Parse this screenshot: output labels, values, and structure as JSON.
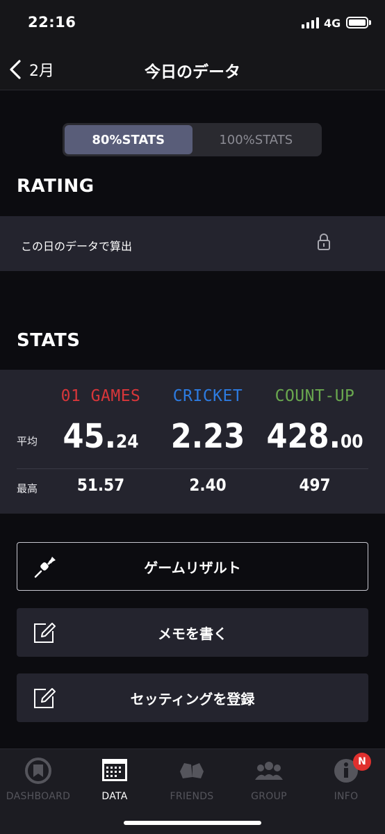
{
  "status_bar": {
    "time": "22:16",
    "network": "4G"
  },
  "nav": {
    "back_label": "2月",
    "title": "今日のデータ"
  },
  "segment": {
    "options": [
      "80%STATS",
      "100%STATS"
    ],
    "selected": "80%STATS"
  },
  "rating": {
    "section_title": "RATING",
    "row_text": "この日のデータで算出"
  },
  "stats": {
    "section_title": "STATS",
    "row_labels": {
      "average": "平均",
      "max": "最高"
    },
    "columns": [
      {
        "name": "01 GAMES",
        "color": "#d8363a",
        "avg_int": "45.",
        "avg_dec": "24",
        "max": "51.57"
      },
      {
        "name": "CRICKET",
        "color": "#2d7be0",
        "avg_int": "2.23",
        "avg_dec": "",
        "max": "2.40"
      },
      {
        "name": "COUNT-UP",
        "color": "#6aa84f",
        "avg_int": "428.",
        "avg_dec": "00",
        "max": "497"
      }
    ]
  },
  "actions": [
    {
      "label": "ゲームリザルト",
      "icon": "dart-icon"
    },
    {
      "label": "メモを書く",
      "icon": "edit-icon"
    },
    {
      "label": "セッティングを登録",
      "icon": "edit-icon"
    }
  ],
  "tabs": [
    {
      "label": "DASHBOARD",
      "icon": "dashboard-icon",
      "active": false
    },
    {
      "label": "DATA",
      "icon": "calendar-icon",
      "active": true
    },
    {
      "label": "FRIENDS",
      "icon": "friends-icon",
      "active": false
    },
    {
      "label": "GROUP",
      "icon": "group-icon",
      "active": false
    },
    {
      "label": "INFO",
      "icon": "info-icon",
      "active": false
    }
  ],
  "info_badge": "N"
}
